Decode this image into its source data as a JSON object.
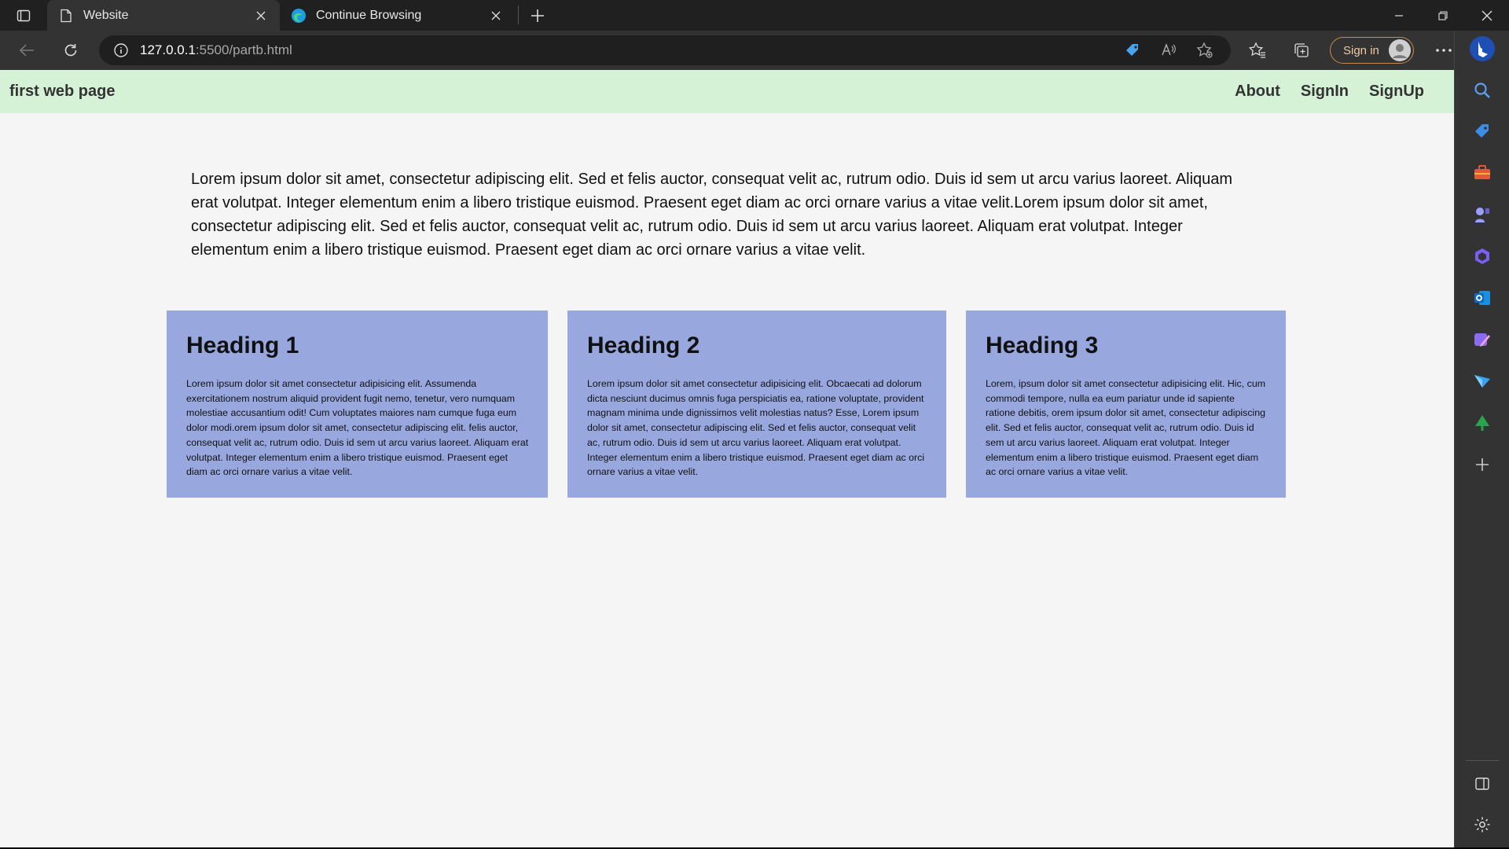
{
  "browser": {
    "tabs": [
      {
        "title": "Website",
        "active": true,
        "icon": "page-icon"
      },
      {
        "title": "Continue Browsing",
        "active": false,
        "icon": "edge-logo-icon"
      }
    ],
    "address": {
      "host": "127.0.0.1",
      "path": ":5500/partb.html"
    },
    "signin_label": "Sign in"
  },
  "page": {
    "navbar": {
      "brand": "first web page",
      "links": [
        "About",
        "SignIn",
        "SignUp"
      ]
    },
    "intro": "Lorem ipsum dolor sit amet, consectetur adipiscing elit. Sed et felis auctor, consequat velit ac, rutrum odio. Duis id sem ut arcu varius laoreet. Aliquam erat volutpat. Integer elementum enim a libero tristique euismod. Praesent eget diam ac orci ornare varius a vitae velit.Lorem ipsum dolor sit amet, consectetur adipiscing elit. Sed et felis auctor, consequat velit ac, rutrum odio. Duis id sem ut arcu varius laoreet. Aliquam erat volutpat. Integer elementum enim a libero tristique euismod. Praesent eget diam ac orci ornare varius a vitae velit.",
    "cards": [
      {
        "heading": "Heading 1",
        "text": "Lorem ipsum dolor sit amet consectetur adipisicing elit. Assumenda exercitationem nostrum aliquid provident fugit nemo, tenetur, vero numquam molestiae accusantium odit! Cum voluptates maiores nam cumque fuga eum dolor modi.orem ipsum dolor sit amet, consectetur adipiscing elit. felis auctor, consequat velit ac, rutrum odio. Duis id sem ut arcu varius laoreet. Aliquam erat volutpat. Integer elementum enim a libero tristique euismod. Praesent eget diam ac orci ornare varius a vitae velit."
      },
      {
        "heading": "Heading 2",
        "text": "Lorem ipsum dolor sit amet consectetur adipisicing elit. Obcaecati ad dolorum dicta nesciunt ducimus omnis fuga perspiciatis ea, ratione voluptate, provident magnam minima unde dignissimos velit molestias natus? Esse, Lorem ipsum dolor sit amet, consectetur adipiscing elit. Sed et felis auctor, consequat velit ac, rutrum odio. Duis id sem ut arcu varius laoreet. Aliquam erat volutpat. Integer elementum enim a libero tristique euismod. Praesent eget diam ac orci ornare varius a vitae velit."
      },
      {
        "heading": "Heading 3",
        "text": "Lorem, ipsum dolor sit amet consectetur adipisicing elit. Hic, cum commodi tempore, nulla ea eum pariatur unde id sapiente ratione debitis, orem ipsum dolor sit amet, consectetur adipiscing elit. Sed et felis auctor, consequat velit ac, rutrum odio. Duis id sem ut arcu varius laoreet. Aliquam erat volutpat. Integer elementum enim a libero tristique euismod. Praesent eget diam ac orci ornare varius a vitae velit."
      }
    ]
  },
  "colors": {
    "navbar_bg": "#d6f2d6",
    "card_bg": "#98a8df",
    "page_bg": "#f5f5f5",
    "chrome_dark": "#202020",
    "toolbar": "#333333"
  }
}
